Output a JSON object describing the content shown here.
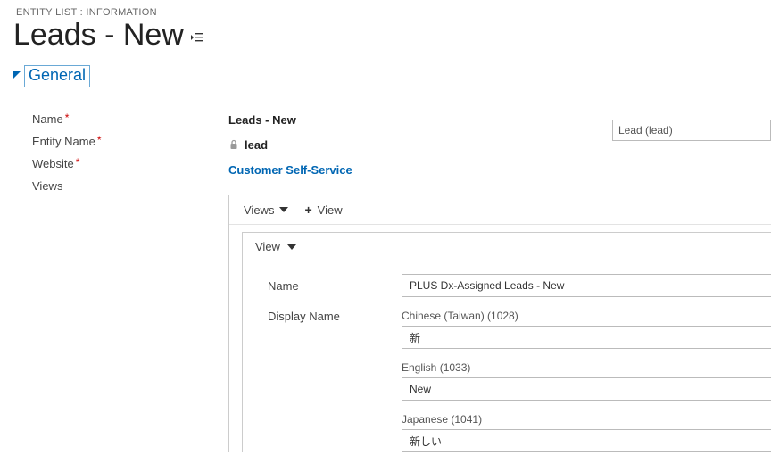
{
  "breadcrumb": "ENTITY LIST : INFORMATION",
  "page_title": "Leads - New",
  "section": {
    "label": "General"
  },
  "fields": {
    "name": {
      "label": "Name",
      "value": "Leads - New"
    },
    "entity_name": {
      "label": "Entity Name",
      "value": "lead",
      "lookup_display": "Lead (lead)"
    },
    "website": {
      "label": "Website",
      "value": "Customer Self-Service"
    },
    "views": {
      "label": "Views"
    }
  },
  "views_panel": {
    "toolbar_views": "Views",
    "toolbar_add": "View",
    "inner_header": "View",
    "form": {
      "name_label": "Name",
      "name_value": "PLUS Dx-Assigned Leads - New",
      "display_name_label": "Display Name",
      "langs": [
        {
          "label": "Chinese (Taiwan) (1028)",
          "value": "新"
        },
        {
          "label": "English (1033)",
          "value": "New"
        },
        {
          "label": "Japanese (1041)",
          "value": "新しい"
        }
      ]
    }
  }
}
